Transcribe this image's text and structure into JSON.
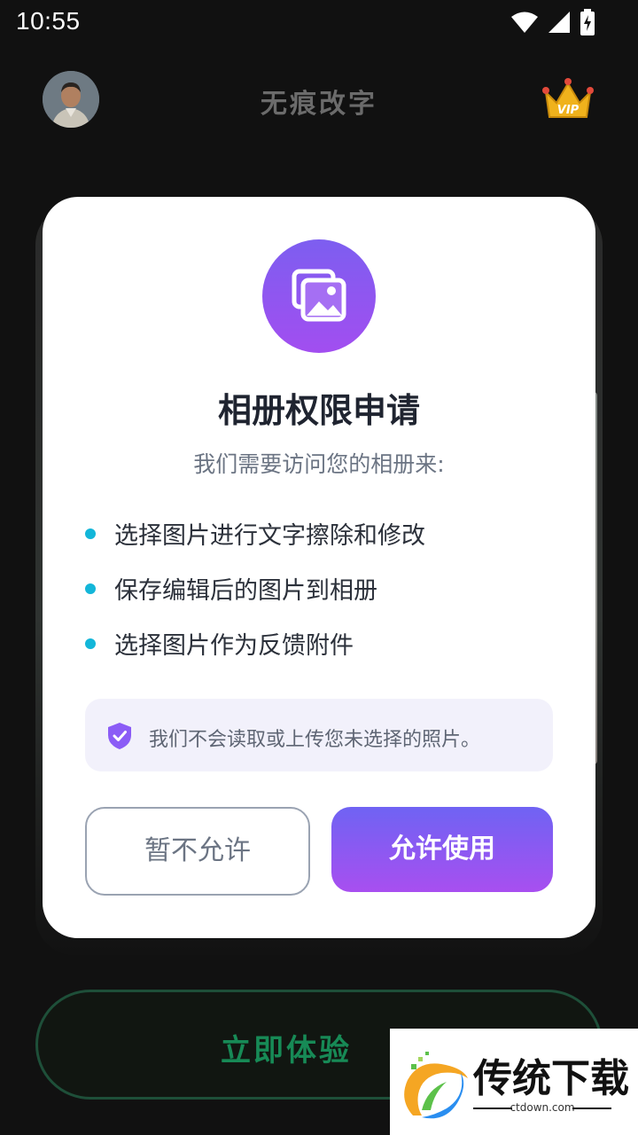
{
  "status_bar": {
    "time": "10:55",
    "icons": [
      "wifi-icon",
      "signal-icon",
      "battery-charging-icon"
    ]
  },
  "header": {
    "title": "无痕改字",
    "vip_badge": "VIP"
  },
  "dialog": {
    "icon": "gallery-icon",
    "title": "相册权限申请",
    "subtitle": "我们需要访问您的相册来:",
    "reasons": [
      "选择图片进行文字擦除和修改",
      "保存编辑后的图片到相册",
      "选择图片作为反馈附件"
    ],
    "privacy_note": "我们不会读取或上传您未选择的照片。",
    "deny_label": "暂不允许",
    "allow_label": "允许使用"
  },
  "cta": {
    "label": "立即体验"
  },
  "watermark": {
    "brand": "传统下载",
    "url": "ctdown.com"
  },
  "colors": {
    "accent_gradient_start": "#6f63f3",
    "accent_gradient_end": "#a84ff0",
    "bullet": "#13b6d9",
    "cta_green": "#178a56"
  }
}
